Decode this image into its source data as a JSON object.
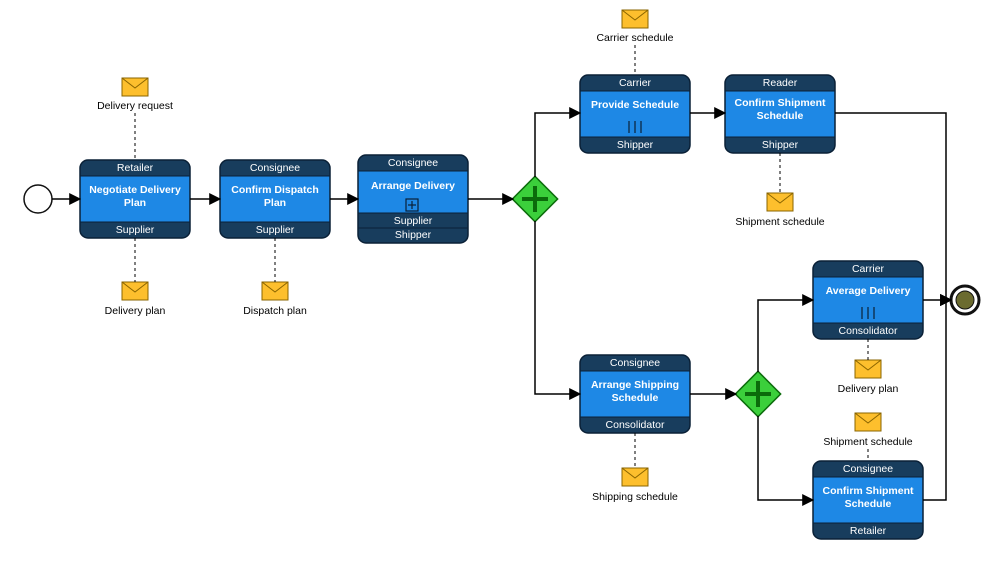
{
  "start": {
    "kind": "start-event"
  },
  "end": {
    "kind": "end-event"
  },
  "gw1": {
    "kind": "parallel-gateway"
  },
  "gw2": {
    "kind": "parallel-gateway"
  },
  "tasks": {
    "negotiate": {
      "top": "Retailer",
      "title1": "Negotiate Delivery",
      "title2": "Plan",
      "bot1": "Supplier"
    },
    "confirmDispatch": {
      "top": "Consignee",
      "title1": "Confirm Dispatch",
      "title2": "Plan",
      "bot1": "Supplier"
    },
    "arrangeDelivery": {
      "top": "Consignee",
      "title1": "Arrange Delivery",
      "title2": "",
      "bot1": "Supplier",
      "bot2": "Shipper",
      "marker": "subprocess"
    },
    "provideSchedule": {
      "top": "Carrier",
      "title1": "Provide Schedule",
      "title2": "",
      "bot1": "Shipper",
      "marker": "parallel"
    },
    "confirmShipmentTop": {
      "top": "Reader",
      "title1": "Confirm Shipment",
      "title2": "Schedule",
      "bot1": "Shipper"
    },
    "arrangeShipping": {
      "top": "Consignee",
      "title1": "Arrange Shipping",
      "title2": "Schedule",
      "bot1": "Consolidator"
    },
    "averageDelivery": {
      "top": "Carrier",
      "title1": "Average Delivery",
      "title2": "",
      "bot1": "Consolidator",
      "marker": "parallel"
    },
    "confirmShipmentBot": {
      "top": "Consignee",
      "title1": "Confirm Shipment",
      "title2": "Schedule",
      "bot1": "Retailer"
    }
  },
  "messages": {
    "deliveryRequest": {
      "label": "Delivery request"
    },
    "deliveryPlan1": {
      "label": "Delivery plan"
    },
    "dispatchPlan": {
      "label": "Dispatch plan"
    },
    "carrierSchedule": {
      "label": "Carrier schedule"
    },
    "shipmentScheduleT": {
      "label": "Shipment schedule"
    },
    "shippingSchedule": {
      "label": "Shipping schedule"
    },
    "deliveryPlan2": {
      "label": "Delivery plan"
    },
    "shipmentScheduleM": {
      "label": "Shipment schedule"
    }
  }
}
